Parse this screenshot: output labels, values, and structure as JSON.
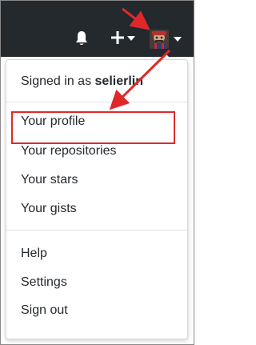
{
  "menu": {
    "signed_in_prefix": "Signed in as ",
    "username": "selierlin",
    "items_group1": [
      "Your profile",
      "Your repositories",
      "Your stars",
      "Your gists"
    ],
    "items_group2": [
      "Help",
      "Settings",
      "Sign out"
    ]
  },
  "colors": {
    "header_bg": "#24292e",
    "annotation_red": "#e0282a"
  },
  "icons": [
    "bell-icon",
    "plus-icon",
    "chevron-down-icon",
    "avatar"
  ]
}
